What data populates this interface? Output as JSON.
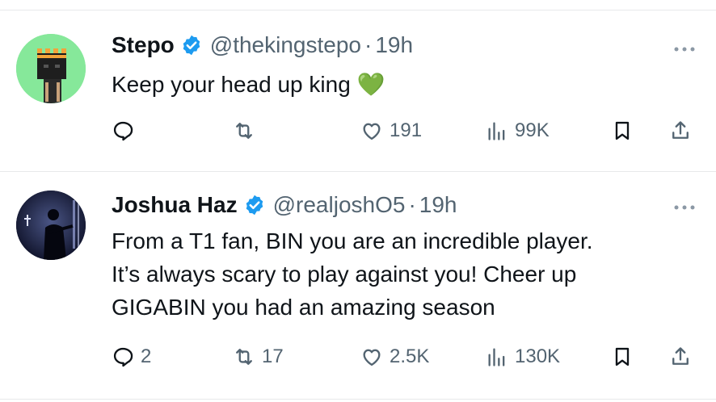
{
  "tweets": [
    {
      "name": "Stepo",
      "handle": "@thekingstepo",
      "separator": "·",
      "time": "19h",
      "text_lines": [
        "Keep your head up king 💚"
      ],
      "replies": "",
      "retweets": "",
      "likes": "191",
      "views": "99K"
    },
    {
      "name": "Joshua Haz",
      "handle": "@realjoshO5",
      "separator": "·",
      "time": "19h",
      "text_lines": [
        "From a T1 fan, BIN you are an incredible player.",
        "It’s always scary to play against you! Cheer up",
        "GIGABIN you had an amazing season"
      ],
      "replies": "2",
      "retweets": "17",
      "likes": "2.5K",
      "views": "130K"
    }
  ],
  "icons": {
    "verified": "verified-badge-icon",
    "more": "more-dots-icon",
    "reply": "reply-icon",
    "retweet": "retweet-icon",
    "like": "heart-icon",
    "views": "views-chart-icon",
    "bookmark": "bookmark-icon",
    "share": "share-icon"
  },
  "colors": {
    "verified": "#1d9bf0",
    "muted": "#536471",
    "text": "#0f1419",
    "avatar1_bg": "#86e89a",
    "avatar2_bg": "#1a1f3a"
  }
}
